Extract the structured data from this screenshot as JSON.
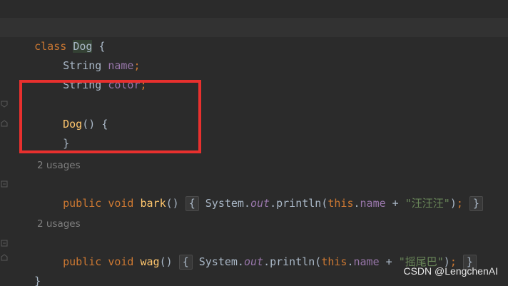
{
  "code": {
    "line1": {
      "kw": "class",
      "name": "Dog",
      "brace": "{"
    },
    "line2": {
      "type": "String",
      "field": "name",
      "semi": ";"
    },
    "line3": {
      "type": "String",
      "field": "color",
      "semi": ";"
    },
    "line5": {
      "method": "Dog",
      "parens": "()",
      "brace": "{"
    },
    "line6": {
      "brace": "}"
    },
    "usages1": "2 usages",
    "line8": {
      "kw1": "public",
      "kw2": "void",
      "method": "bark",
      "parens": "()",
      "open": "{",
      "sys": "System.",
      "out": "out",
      "println": ".println(",
      "this": "this",
      "dot": ".",
      "field": "name",
      "plus": " + ",
      "str": "\"汪汪汪\"",
      "close_paren": ")",
      "semi": ";",
      "close": "}"
    },
    "usages2": "2 usages",
    "line10": {
      "kw1": "public",
      "kw2": "void",
      "method": "wag",
      "parens": "()",
      "open": "{",
      "sys": "System.",
      "out": "out",
      "println": ".println(",
      "this": "this",
      "dot": ".",
      "field": "name",
      "plus": " + ",
      "str": "\"摇尾巴\"",
      "close_paren": ")",
      "semi": ";",
      "close": "}"
    },
    "line11": {
      "brace": "}"
    }
  },
  "watermark": "CSDN @LengchenAI",
  "colors": {
    "background": "#2b2b2b",
    "keyword": "#cc7832",
    "field": "#9876aa",
    "method": "#ffc66d",
    "string": "#6a8759",
    "highlight_box": "#e8302e"
  }
}
